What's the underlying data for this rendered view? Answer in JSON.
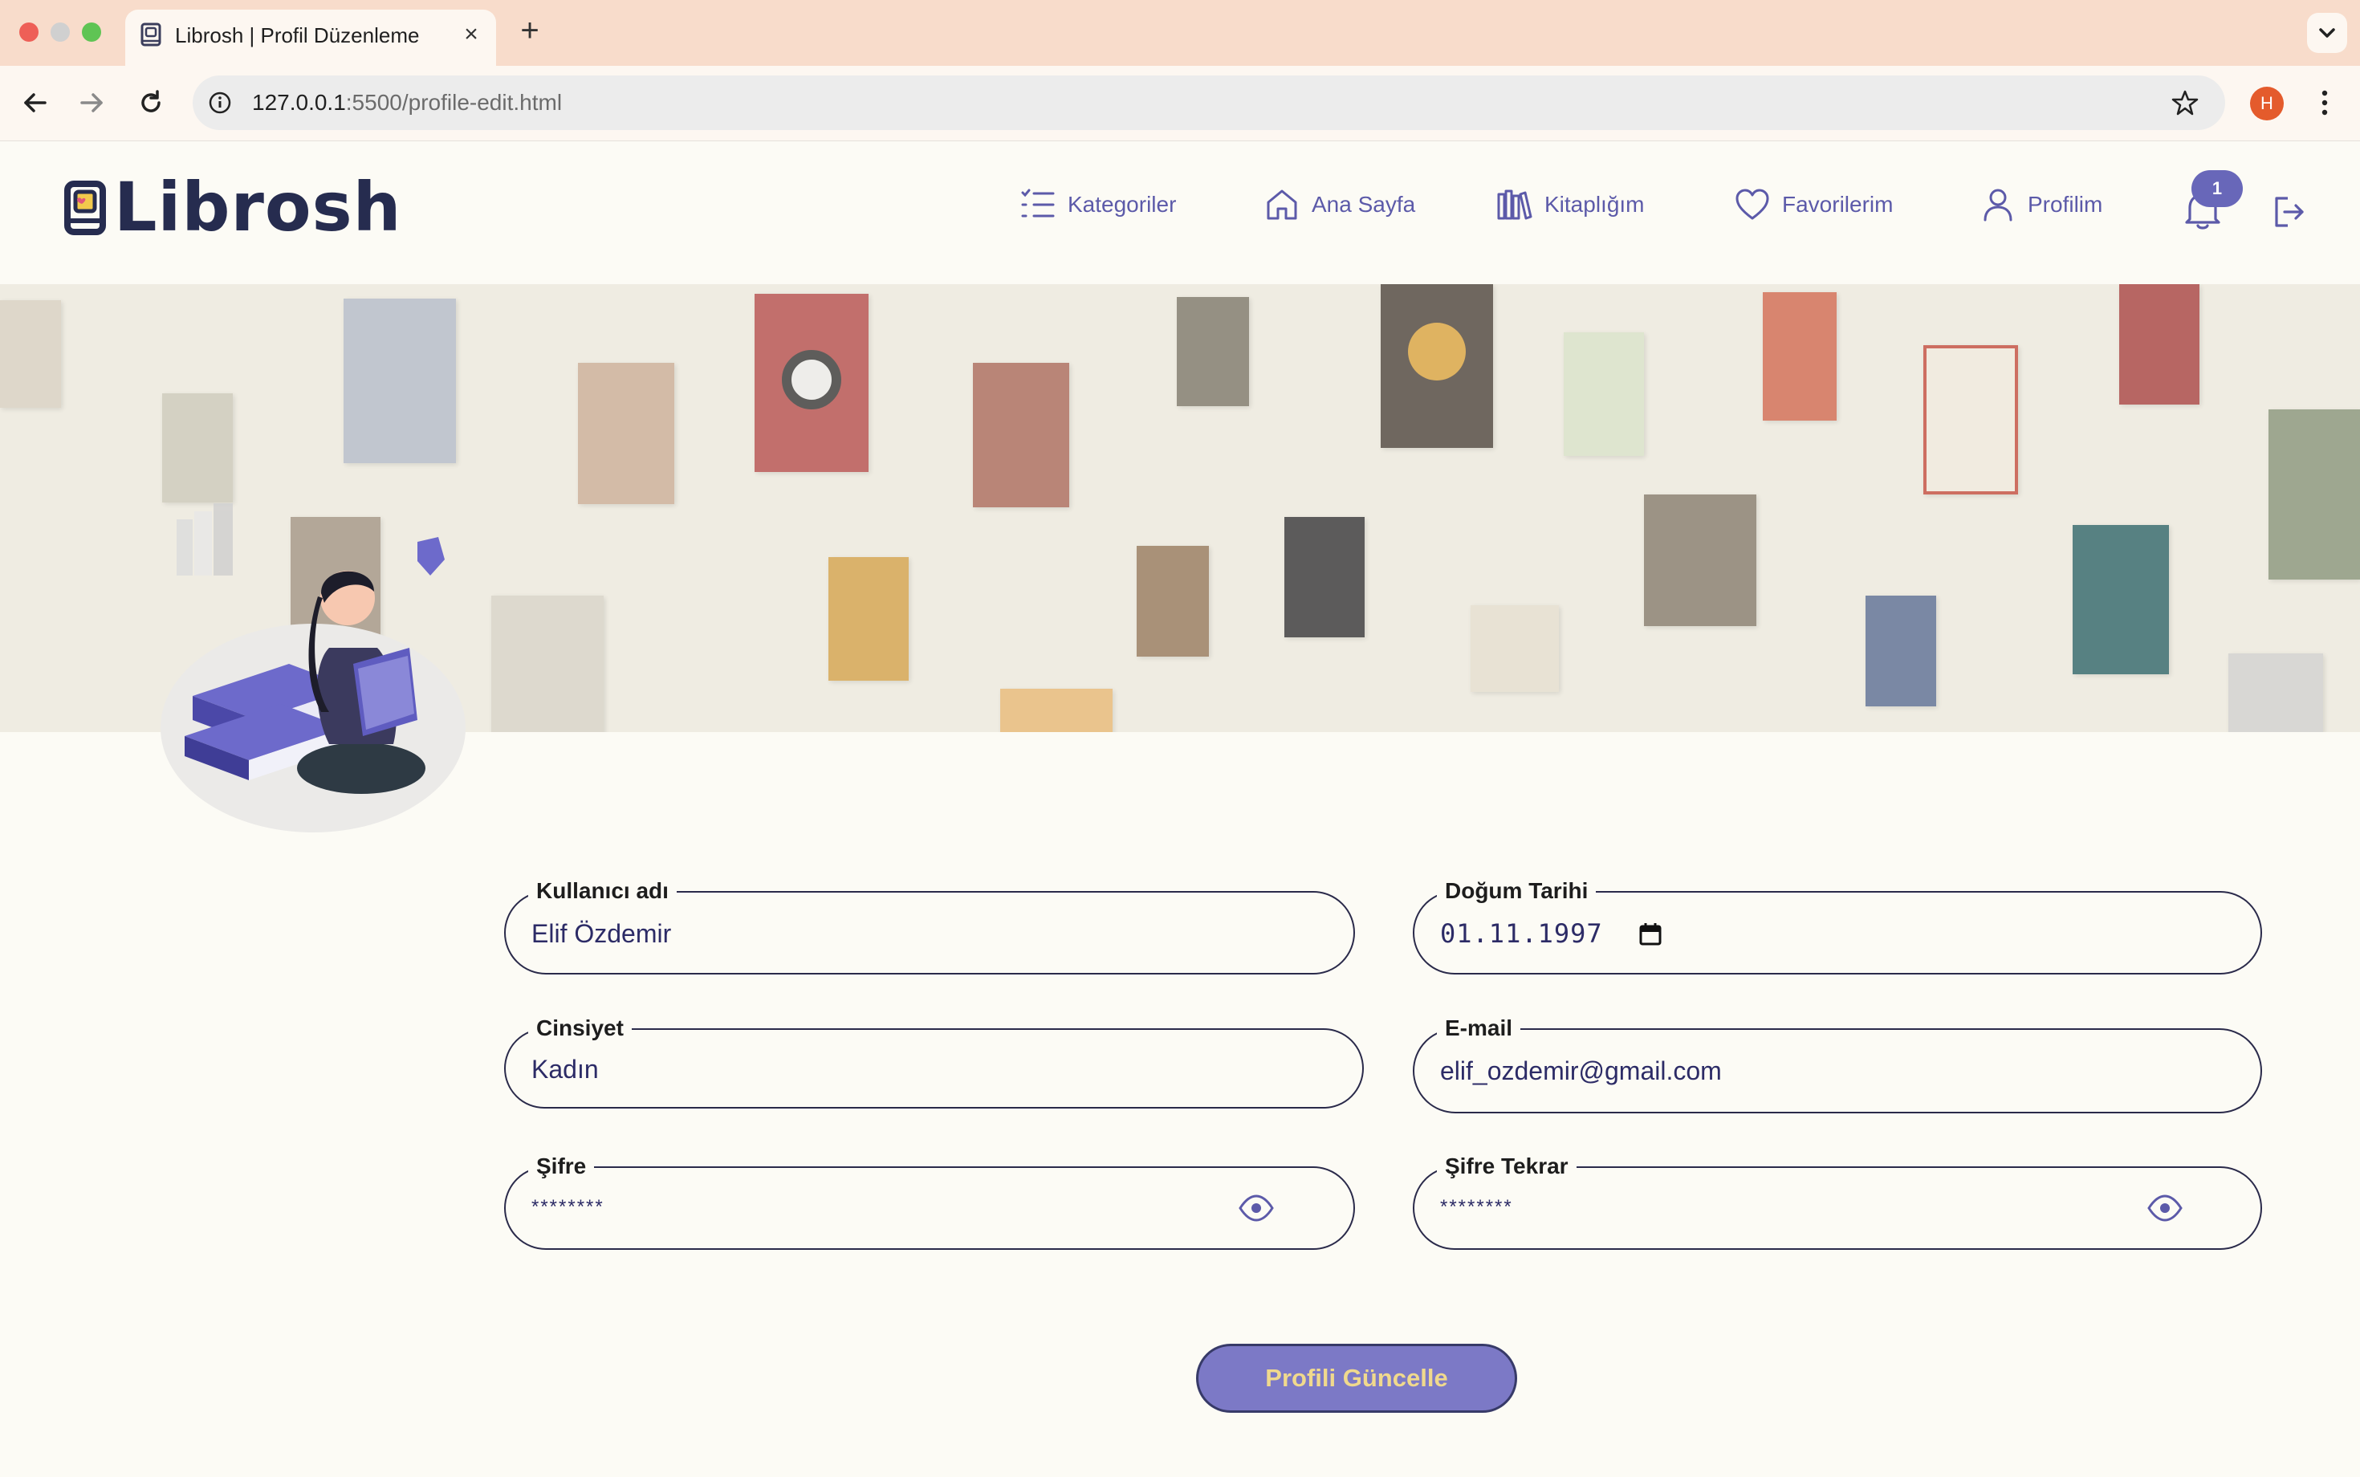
{
  "browser": {
    "tab_title": "Librosh | Profil Düzenleme",
    "url_host": "127.0.0.1",
    "url_rest": ":5500/profile-edit.html",
    "profile_initial": "H"
  },
  "brand": {
    "name": "Librosh",
    "accent": "#6867b9",
    "navy": "#262c4f"
  },
  "nav": {
    "categories": "Kategoriler",
    "home": "Ana Sayfa",
    "library": "Kitaplığım",
    "favorites": "Favorilerim",
    "profile": "Profilim",
    "notification_count": "1"
  },
  "form": {
    "username": {
      "label": "Kullanıcı adı",
      "value": "Elif Özdemir"
    },
    "birthdate": {
      "label": "Doğum Tarihi",
      "value": "01.11.1997"
    },
    "gender": {
      "label": "Cinsiyet",
      "value": "Kadın"
    },
    "email": {
      "label": "E-mail",
      "value": "elif_ozdemir@gmail.com"
    },
    "password": {
      "label": "Şifre",
      "value": "********"
    },
    "password_repeat": {
      "label": "Şifre Tekrar",
      "value": "********"
    },
    "submit_label": "Profili Güncelle"
  }
}
